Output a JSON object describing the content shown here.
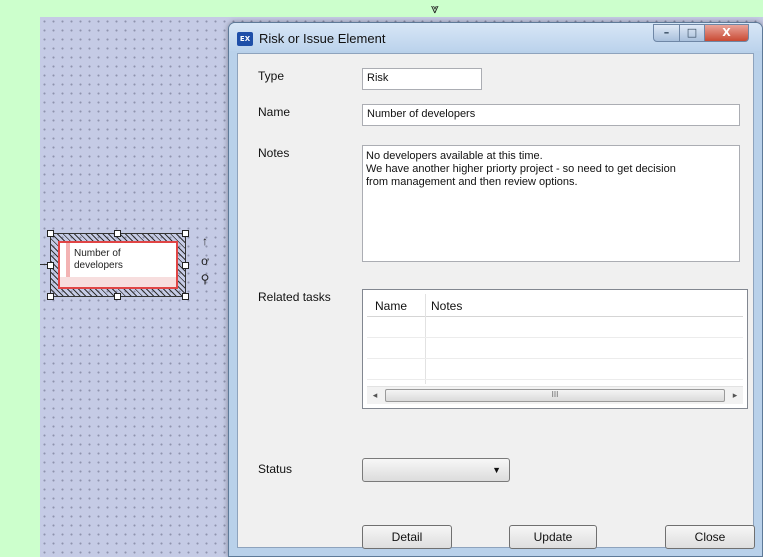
{
  "diagram": {
    "node_label": "Number of developers",
    "tools": {
      "up_icon": "↑",
      "link_icon": "ơ",
      "zoom_icon": "⚲"
    },
    "top_arrow": "⩔"
  },
  "window": {
    "icon_text": "EX",
    "title": "Risk or Issue Element",
    "controls": {
      "minimize": "–",
      "maximize": "□",
      "close": "X"
    }
  },
  "form": {
    "type_label": "Type",
    "type_value": "Risk",
    "name_label": "Name",
    "name_value": "Number of developers",
    "notes_label": "Notes",
    "notes_value": "No developers available at this time.\nWe have another higher priorty project - so need to get decision\nfrom management and then review options.",
    "related_label": "Related tasks",
    "related_columns": [
      "Name",
      "Notes"
    ],
    "scroll_left": "◂",
    "scroll_right": "▸",
    "scroll_thumb": "III",
    "status_label": "Status",
    "status_value": "",
    "status_arrow": "▼"
  },
  "buttons": {
    "detail": "Detail",
    "update": "Update",
    "close": "Close"
  },
  "colors": {
    "canvas_bg": "#c5cbe5",
    "page_bg": "#ccffcc",
    "node_border": "#e04545"
  }
}
